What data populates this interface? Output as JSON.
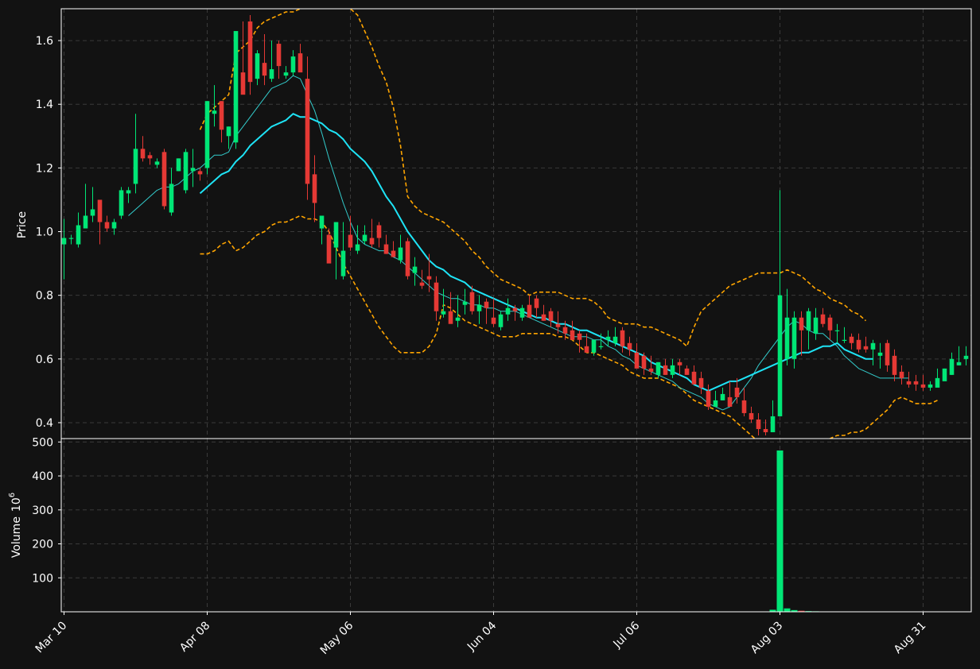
{
  "theme": {
    "background": "#121212",
    "up_color": "#00e676",
    "down_color": "#e53935",
    "volume_up_color": "#00e676",
    "volume_down_color": "#e53935",
    "sma_color": "#33cccc",
    "ema_color": "#1ee3f5",
    "band_color": "#ffa500",
    "grid_color": "#3a3a3a",
    "text_color": "#ffffff"
  },
  "chart_data": {
    "type": "candlestick",
    "grid": true,
    "price_panel": {
      "ylabel": "Price",
      "ylim": [
        0.35,
        1.7
      ],
      "yticks": [
        0.4,
        0.6,
        0.8,
        1.0,
        1.2,
        1.4,
        1.6
      ],
      "ytick_labels": [
        "0.4",
        "0.6",
        "0.8",
        "1.0",
        "1.2",
        "1.4",
        "1.6"
      ]
    },
    "volume_panel": {
      "ylabel": "Volume",
      "ylabel_exponent": "10",
      "ylabel_power": "6",
      "ylim": [
        0,
        510
      ],
      "yticks": [
        100,
        200,
        300,
        400,
        500
      ],
      "ytick_labels": [
        "100",
        "200",
        "300",
        "400",
        "500"
      ]
    },
    "x_axis": {
      "labels": [
        "Mar 10",
        "Apr 08",
        "May 06",
        "Jun 04",
        "Jul 06",
        "Aug 03",
        "Aug 31"
      ],
      "label_index": [
        0,
        20,
        40,
        60,
        80,
        100,
        120
      ]
    },
    "candles": {
      "open": [
        0.96,
        0.98,
        0.96,
        1.01,
        1.05,
        1.1,
        1.03,
        1.01,
        1.05,
        1.12,
        1.15,
        1.26,
        1.24,
        1.21,
        1.25,
        1.06,
        1.19,
        1.13,
        1.19,
        1.19,
        1.2,
        1.37,
        1.41,
        1.3,
        1.28,
        1.5,
        1.66,
        1.48,
        1.53,
        1.48,
        1.59,
        1.49,
        1.5,
        1.56,
        1.48,
        1.18,
        1.01,
        0.99,
        0.95,
        0.86,
        0.99,
        0.94,
        0.97,
        0.98,
        1.02,
        0.96,
        0.94,
        0.91,
        0.97,
        0.87,
        0.84,
        0.86,
        0.84,
        0.74,
        0.75,
        0.72,
        0.77,
        0.81,
        0.75,
        0.78,
        0.73,
        0.7,
        0.74,
        0.76,
        0.73,
        0.77,
        0.79,
        0.74,
        0.75,
        0.71,
        0.7,
        0.69,
        0.68,
        0.64,
        0.62,
        0.64,
        0.66,
        0.65,
        0.69,
        0.65,
        0.62,
        0.61,
        0.57,
        0.55,
        0.58,
        0.55,
        0.59,
        0.57,
        0.56,
        0.54,
        0.5,
        0.45,
        0.47,
        0.48,
        0.51,
        0.47,
        0.43,
        0.41,
        0.38,
        0.37,
        0.42,
        0.6,
        0.6,
        0.73,
        0.69,
        0.68,
        0.74,
        0.73,
        0.69,
        0.66,
        0.67,
        0.66,
        0.64,
        0.63,
        0.61,
        0.65,
        0.61,
        0.56,
        0.53,
        0.53,
        0.52,
        0.51,
        0.51,
        0.53,
        0.55,
        0.58,
        0.6
      ],
      "high": [
        1.04,
        0.99,
        1.06,
        1.15,
        1.14,
        1.1,
        1.05,
        1.04,
        1.14,
        1.14,
        1.37,
        1.3,
        1.25,
        1.23,
        1.26,
        1.2,
        1.23,
        1.26,
        1.26,
        1.2,
        1.41,
        1.46,
        1.41,
        1.33,
        1.3,
        1.66,
        1.68,
        1.57,
        1.62,
        1.6,
        1.6,
        1.52,
        1.57,
        1.59,
        1.55,
        1.24,
        1.02,
        1.01,
        1.03,
        1.03,
        1.05,
        1.02,
        1.02,
        1.04,
        1.03,
        0.99,
        0.97,
        0.99,
        0.98,
        0.92,
        0.88,
        0.93,
        0.86,
        0.82,
        0.81,
        0.8,
        0.82,
        0.83,
        0.8,
        0.79,
        0.79,
        0.75,
        0.79,
        0.77,
        0.77,
        0.8,
        0.8,
        0.77,
        0.76,
        0.75,
        0.72,
        0.72,
        0.69,
        0.68,
        0.66,
        0.68,
        0.69,
        0.7,
        0.7,
        0.67,
        0.65,
        0.62,
        0.61,
        0.59,
        0.6,
        0.6,
        0.6,
        0.58,
        0.58,
        0.56,
        0.52,
        0.5,
        0.51,
        0.53,
        0.54,
        0.51,
        0.45,
        0.43,
        0.41,
        0.47,
        1.13,
        0.82,
        0.75,
        0.75,
        0.76,
        0.76,
        0.76,
        0.74,
        0.71,
        0.7,
        0.68,
        0.68,
        0.67,
        0.66,
        0.65,
        0.66,
        0.63,
        0.58,
        0.56,
        0.55,
        0.55,
        0.53,
        0.57,
        0.57,
        0.62,
        0.64,
        0.64
      ],
      "low": [
        0.85,
        0.96,
        0.95,
        1.01,
        1.03,
        0.96,
        1.0,
        0.99,
        1.04,
        1.09,
        1.12,
        1.22,
        1.21,
        1.2,
        1.07,
        1.05,
        1.19,
        1.12,
        1.14,
        1.16,
        1.18,
        1.33,
        1.28,
        1.26,
        1.26,
        1.48,
        1.43,
        1.46,
        1.46,
        1.47,
        1.48,
        1.48,
        1.49,
        1.52,
        1.1,
        1.03,
        0.96,
        0.94,
        0.85,
        0.85,
        0.94,
        0.93,
        0.96,
        0.95,
        0.95,
        0.93,
        0.92,
        0.9,
        0.85,
        0.83,
        0.82,
        0.81,
        0.72,
        0.73,
        0.72,
        0.7,
        0.74,
        0.74,
        0.71,
        0.71,
        0.7,
        0.69,
        0.72,
        0.72,
        0.72,
        0.74,
        0.73,
        0.72,
        0.7,
        0.68,
        0.66,
        0.66,
        0.62,
        0.62,
        0.61,
        0.63,
        0.64,
        0.64,
        0.62,
        0.61,
        0.58,
        0.55,
        0.55,
        0.54,
        0.55,
        0.54,
        0.55,
        0.55,
        0.52,
        0.49,
        0.44,
        0.45,
        0.47,
        0.47,
        0.46,
        0.42,
        0.4,
        0.36,
        0.36,
        0.37,
        0.55,
        0.58,
        0.57,
        0.61,
        0.63,
        0.66,
        0.7,
        0.66,
        0.65,
        0.65,
        0.63,
        0.62,
        0.62,
        0.58,
        0.57,
        0.56,
        0.53,
        0.52,
        0.51,
        0.5,
        0.5,
        0.5,
        0.52,
        0.54,
        0.55,
        0.58,
        0.58
      ],
      "close": [
        0.98,
        0.98,
        1.02,
        1.05,
        1.07,
        1.03,
        1.01,
        1.03,
        1.13,
        1.13,
        1.26,
        1.23,
        1.23,
        1.22,
        1.08,
        1.15,
        1.23,
        1.25,
        1.2,
        1.18,
        1.41,
        1.38,
        1.32,
        1.33,
        1.63,
        1.43,
        1.47,
        1.56,
        1.49,
        1.51,
        1.52,
        1.5,
        1.55,
        1.5,
        1.15,
        1.09,
        1.05,
        0.9,
        1.03,
        0.94,
        0.95,
        0.96,
        0.99,
        0.96,
        0.98,
        0.93,
        0.92,
        0.95,
        0.86,
        0.89,
        0.83,
        0.85,
        0.75,
        0.75,
        0.71,
        0.73,
        0.78,
        0.75,
        0.77,
        0.76,
        0.71,
        0.74,
        0.76,
        0.75,
        0.76,
        0.73,
        0.76,
        0.72,
        0.72,
        0.7,
        0.68,
        0.66,
        0.66,
        0.62,
        0.66,
        0.64,
        0.67,
        0.67,
        0.64,
        0.63,
        0.57,
        0.57,
        0.56,
        0.59,
        0.55,
        0.58,
        0.58,
        0.55,
        0.52,
        0.51,
        0.45,
        0.47,
        0.49,
        0.45,
        0.48,
        0.43,
        0.41,
        0.38,
        0.37,
        0.42,
        0.8,
        0.73,
        0.73,
        0.69,
        0.75,
        0.73,
        0.71,
        0.69,
        0.69,
        0.66,
        0.65,
        0.63,
        0.63,
        0.65,
        0.62,
        0.58,
        0.55,
        0.54,
        0.52,
        0.52,
        0.51,
        0.52,
        0.54,
        0.57,
        0.6,
        0.59,
        0.61
      ]
    },
    "volume": [
      0.5,
      0.5,
      0.4,
      0.4,
      0.4,
      0.3,
      0.3,
      0.3,
      0.3,
      0.3,
      0.4,
      0.4,
      0.3,
      0.3,
      0.3,
      0.3,
      0.3,
      0.3,
      0.3,
      0.3,
      1.2,
      0.6,
      0.5,
      0.4,
      0.5,
      0.4,
      0.4,
      0.4,
      0.3,
      0.3,
      0.3,
      0.3,
      0.3,
      0.3,
      0.5,
      0.4,
      0.4,
      0.4,
      0.4,
      0.3,
      0.3,
      0.3,
      0.3,
      0.3,
      0.3,
      0.3,
      0.3,
      0.3,
      0.3,
      0.3,
      0.3,
      0.3,
      0.3,
      0.3,
      0.3,
      0.3,
      0.3,
      0.3,
      0.3,
      0.3,
      0.3,
      0.3,
      0.3,
      0.3,
      0.3,
      0.3,
      0.3,
      0.3,
      0.3,
      0.3,
      0.3,
      0.3,
      0.3,
      0.3,
      0.3,
      0.3,
      0.3,
      0.3,
      0.3,
      0.3,
      0.3,
      0.3,
      0.3,
      0.3,
      0.3,
      0.3,
      0.3,
      0.3,
      0.3,
      0.3,
      0.3,
      0.3,
      0.3,
      0.3,
      0.3,
      0.3,
      0.3,
      0.3,
      0.3,
      6,
      475,
      10,
      5,
      3,
      2,
      1.5,
      1,
      1,
      0.8,
      0.6,
      0.5,
      0.5,
      0.5,
      0.4,
      0.4,
      0.4,
      0.4,
      0.4,
      0.4,
      0.4,
      0.4,
      0.4,
      0.4,
      0.4,
      0.4,
      0.4,
      0.4
    ],
    "moving_average_thin": {
      "start_index": 9,
      "values": [
        1.05,
        1.07,
        1.09,
        1.11,
        1.13,
        1.14,
        1.14,
        1.15,
        1.17,
        1.19,
        1.2,
        1.22,
        1.24,
        1.24,
        1.25,
        1.3,
        1.33,
        1.36,
        1.39,
        1.42,
        1.45,
        1.46,
        1.47,
        1.49,
        1.48,
        1.43,
        1.38,
        1.31,
        1.23,
        1.16,
        1.09,
        1.03,
        0.98,
        0.96,
        0.95,
        0.94,
        0.94,
        0.92,
        0.91,
        0.89,
        0.87,
        0.85,
        0.83,
        0.81,
        0.8,
        0.79,
        0.79,
        0.78,
        0.77,
        0.77,
        0.76,
        0.76,
        0.75,
        0.75,
        0.75,
        0.74,
        0.73,
        0.72,
        0.71,
        0.7,
        0.69,
        0.68,
        0.67,
        0.67,
        0.67,
        0.66,
        0.66,
        0.64,
        0.63,
        0.61,
        0.6,
        0.58,
        0.57,
        0.56,
        0.55,
        0.54,
        0.53,
        0.51,
        0.5,
        0.49,
        0.48,
        0.46,
        0.45,
        0.44,
        0.45,
        0.48,
        0.51,
        0.54,
        0.58,
        0.61,
        0.64,
        0.67,
        0.7,
        0.72,
        0.71,
        0.69,
        0.68,
        0.68,
        0.66,
        0.64,
        0.61,
        0.59,
        0.57,
        0.56,
        0.55,
        0.54,
        0.54,
        0.54,
        0.54,
        0.54
      ]
    },
    "moving_average_thick": {
      "start_index": 19,
      "values": [
        1.12,
        1.14,
        1.16,
        1.18,
        1.19,
        1.22,
        1.24,
        1.27,
        1.29,
        1.31,
        1.33,
        1.34,
        1.35,
        1.37,
        1.36,
        1.36,
        1.35,
        1.34,
        1.32,
        1.31,
        1.29,
        1.26,
        1.24,
        1.22,
        1.19,
        1.15,
        1.11,
        1.08,
        1.04,
        1.0,
        0.97,
        0.94,
        0.91,
        0.89,
        0.88,
        0.86,
        0.85,
        0.84,
        0.82,
        0.81,
        0.8,
        0.79,
        0.78,
        0.77,
        0.76,
        0.75,
        0.74,
        0.73,
        0.73,
        0.72,
        0.71,
        0.71,
        0.7,
        0.69,
        0.69,
        0.68,
        0.67,
        0.66,
        0.65,
        0.64,
        0.63,
        0.62,
        0.61,
        0.59,
        0.58,
        0.57,
        0.56,
        0.55,
        0.54,
        0.52,
        0.51,
        0.5,
        0.51,
        0.52,
        0.53,
        0.53,
        0.54,
        0.55,
        0.56,
        0.57,
        0.58,
        0.59,
        0.6,
        0.61,
        0.62,
        0.62,
        0.63,
        0.64,
        0.64,
        0.65,
        0.63,
        0.62,
        0.61,
        0.6,
        0.6
      ]
    },
    "bands_upper": {
      "start_index": 19,
      "values": [
        1.32,
        1.37,
        1.39,
        1.41,
        1.43,
        1.56,
        1.58,
        1.6,
        1.64,
        1.66,
        1.67,
        1.68,
        1.69,
        1.69,
        1.7,
        1.73,
        1.76,
        1.74,
        1.73,
        1.72,
        1.71,
        1.7,
        1.68,
        1.63,
        1.58,
        1.52,
        1.47,
        1.39,
        1.27,
        1.11,
        1.08,
        1.06,
        1.05,
        1.04,
        1.03,
        1.01,
        0.99,
        0.97,
        0.94,
        0.92,
        0.89,
        0.87,
        0.85,
        0.84,
        0.83,
        0.82,
        0.8,
        0.81,
        0.81,
        0.81,
        0.81,
        0.8,
        0.79,
        0.79,
        0.79,
        0.78,
        0.76,
        0.73,
        0.72,
        0.71,
        0.71,
        0.71,
        0.7,
        0.7,
        0.69,
        0.68,
        0.67,
        0.66,
        0.64,
        0.7,
        0.75,
        0.77,
        0.79,
        0.81,
        0.83,
        0.84,
        0.85,
        0.86,
        0.87,
        0.87,
        0.87,
        0.87,
        0.88,
        0.87,
        0.86,
        0.84,
        0.82,
        0.81,
        0.79,
        0.78,
        0.77,
        0.75,
        0.74,
        0.72
      ]
    },
    "bands_lower": {
      "start_index": 19,
      "values": [
        0.93,
        0.93,
        0.94,
        0.96,
        0.97,
        0.94,
        0.95,
        0.97,
        0.99,
        1.0,
        1.02,
        1.03,
        1.03,
        1.04,
        1.05,
        1.04,
        1.04,
        1.03,
        1.0,
        0.95,
        0.9,
        0.86,
        0.82,
        0.78,
        0.74,
        0.7,
        0.67,
        0.64,
        0.62,
        0.62,
        0.62,
        0.62,
        0.64,
        0.68,
        0.77,
        0.76,
        0.74,
        0.72,
        0.71,
        0.7,
        0.69,
        0.68,
        0.67,
        0.67,
        0.67,
        0.68,
        0.68,
        0.68,
        0.68,
        0.68,
        0.67,
        0.67,
        0.66,
        0.64,
        0.62,
        0.62,
        0.61,
        0.6,
        0.59,
        0.58,
        0.56,
        0.55,
        0.54,
        0.54,
        0.54,
        0.53,
        0.52,
        0.51,
        0.49,
        0.47,
        0.46,
        0.45,
        0.44,
        0.43,
        0.42,
        0.4,
        0.38,
        0.36,
        0.34,
        0.31,
        0.28,
        0.26,
        0.24,
        0.25,
        0.27,
        0.29,
        0.31,
        0.34,
        0.35,
        0.36,
        0.36,
        0.37,
        0.37,
        0.38,
        0.4,
        0.42,
        0.44,
        0.47,
        0.48,
        0.47,
        0.46,
        0.46,
        0.46,
        0.47
      ]
    }
  }
}
